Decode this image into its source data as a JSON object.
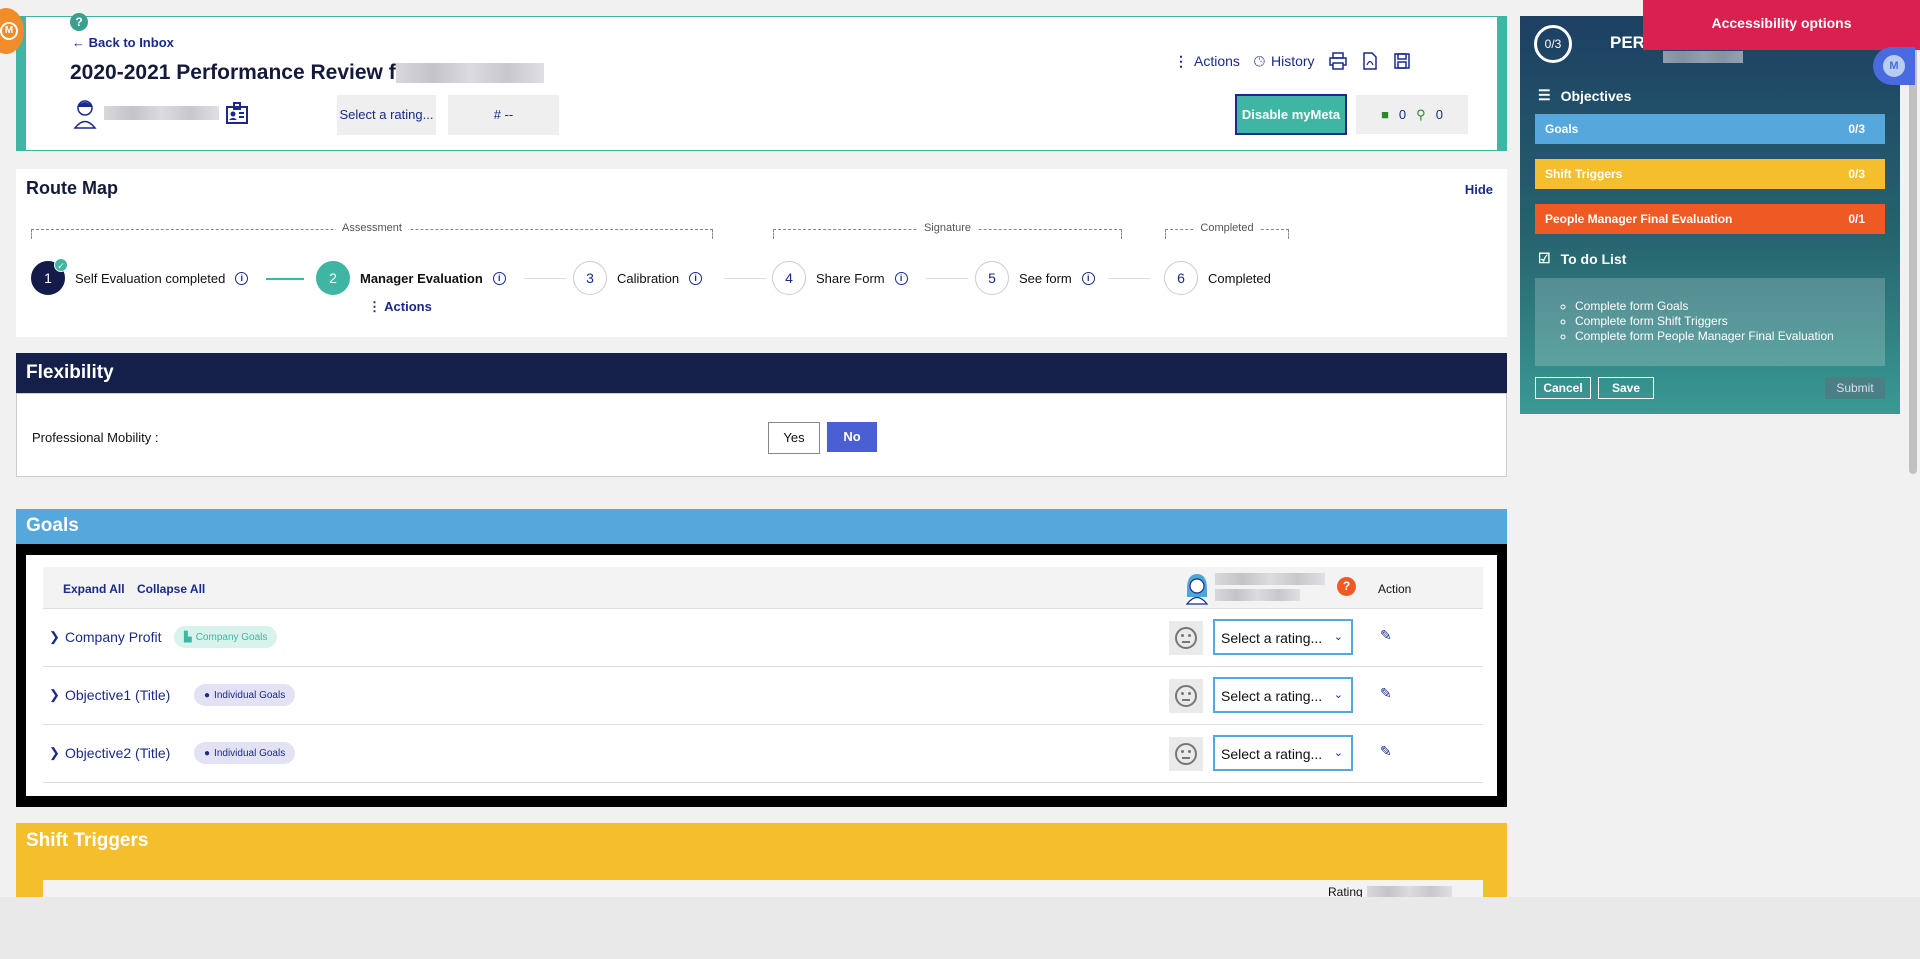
{
  "header": {
    "help": "?",
    "back_label": "Back to Inbox",
    "title": "2020-2021 Performance Review f",
    "select_rating": "Select a rating...",
    "number": "# --",
    "actions": "Actions",
    "history": "History",
    "disable_mymeta": "Disable myMeta",
    "comments_count": "0",
    "attachments_count": "0"
  },
  "route_map": {
    "title": "Route Map",
    "hide": "Hide",
    "groups": [
      "Assessment",
      "Signature",
      "Completed"
    ],
    "steps": [
      {
        "num": "1",
        "label": "Self Evaluation completed"
      },
      {
        "num": "2",
        "label": "Manager Evaluation"
      },
      {
        "num": "3",
        "label": "Calibration"
      },
      {
        "num": "4",
        "label": "Share Form"
      },
      {
        "num": "5",
        "label": "See form"
      },
      {
        "num": "6",
        "label": "Completed"
      }
    ],
    "step_actions": "Actions"
  },
  "flexibility": {
    "title": "Flexibility",
    "mobility_label": "Professional Mobility :",
    "yes": "Yes",
    "no": "No"
  },
  "goals": {
    "title": "Goals",
    "expand_all": "Expand All",
    "collapse_all": "Collapse All",
    "action_header": "Action",
    "rows": [
      {
        "title": "Company Profit",
        "badge": "Company Goals",
        "rating": "Select a rating..."
      },
      {
        "title": "Objective1 (Title)",
        "badge": "Individual Goals",
        "rating": "Select a rating..."
      },
      {
        "title": "Objective2 (Title)",
        "badge": "Individual Goals",
        "rating": "Select a rating..."
      }
    ]
  },
  "shift_triggers": {
    "title": "Shift Triggers",
    "rating_label": "Rating"
  },
  "side_panel": {
    "progress": "0/3",
    "title": "PERI",
    "accessibility": "Accessibility options",
    "avatar_letter": "M",
    "objectives_label": "Objectives",
    "objectives": [
      {
        "name": "Goals",
        "count": "0/3",
        "color": "#56a7db"
      },
      {
        "name": "Shift Triggers",
        "count": "0/3",
        "color": "#f4be2c"
      },
      {
        "name": "People Manager Final Evaluation",
        "count": "0/1",
        "color": "#ef5a24"
      }
    ],
    "todo_label": "To do List",
    "todo": [
      "Complete form Goals",
      "Complete form Shift Triggers",
      "Complete form People Manager Final Evaluation"
    ],
    "cancel": "Cancel",
    "save": "Save",
    "submit": "Submit"
  },
  "colors": {
    "teal": "#3fb5a3",
    "navy": "#141f4a",
    "goals_blue": "#56a7db",
    "shift_yellow": "#f4be2c",
    "final_orange": "#ef5a24",
    "access_red": "#d9204f"
  }
}
